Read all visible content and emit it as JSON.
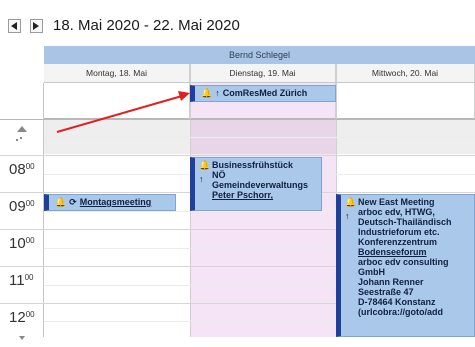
{
  "header": {
    "prev_icon": "triangle-left-icon",
    "next_icon": "triangle-right-icon",
    "date_range": "18. Mai 2020 - 22. Mai 2020"
  },
  "resource": {
    "name": "Bernd Schlegel"
  },
  "days": [
    {
      "label": "Montag, 18. Mai"
    },
    {
      "label": "Dienstag, 19. Mai"
    },
    {
      "label": "Mittwoch, 20. Mai"
    }
  ],
  "hours": [
    {
      "hour": "08",
      "minutes": "00"
    },
    {
      "hour": "09",
      "minutes": "00"
    },
    {
      "hour": "10",
      "minutes": "00"
    },
    {
      "hour": "11",
      "minutes": "00"
    },
    {
      "hour": "12",
      "minutes": "00"
    }
  ],
  "appointments": {
    "allday_tuesday": {
      "title": "ComResMed Zürich",
      "icons": [
        "bell-icon",
        "priority-arrow-icon"
      ]
    },
    "tuesday_8": {
      "lines": [
        "Businessfrühstück",
        "NÖ",
        "Gemeindeverwaltungs",
        "Peter Pschorr,"
      ],
      "icons": [
        "bell-icon",
        "priority-arrow-icon"
      ]
    },
    "monday_9": {
      "title": "Montagsmeeting",
      "icons": [
        "bell-icon",
        "recurring-icon"
      ]
    },
    "wednesday_9": {
      "lines": [
        "New East Meeting",
        "arboc edv, HTWG,",
        "Deutsch-Thailändisch",
        "Industrieforum etc.",
        "Konferenzzentrum",
        "Bodenseeforum",
        "arboc edv consulting",
        "GmbH",
        "Johann Renner",
        "Seestraße 47",
        "D-78464 Konstanz",
        "(urlcobra://goto/add"
      ],
      "icons": [
        "bell-icon",
        "priority-arrow-icon"
      ]
    }
  },
  "colors": {
    "resource_bar": "#a9c4e4",
    "appointment_fill": "#a9c8ea",
    "appointment_border": "#1f3f9a",
    "selected_day_fill": "#f5e4f5",
    "annotation_arrow": "#e02020"
  }
}
